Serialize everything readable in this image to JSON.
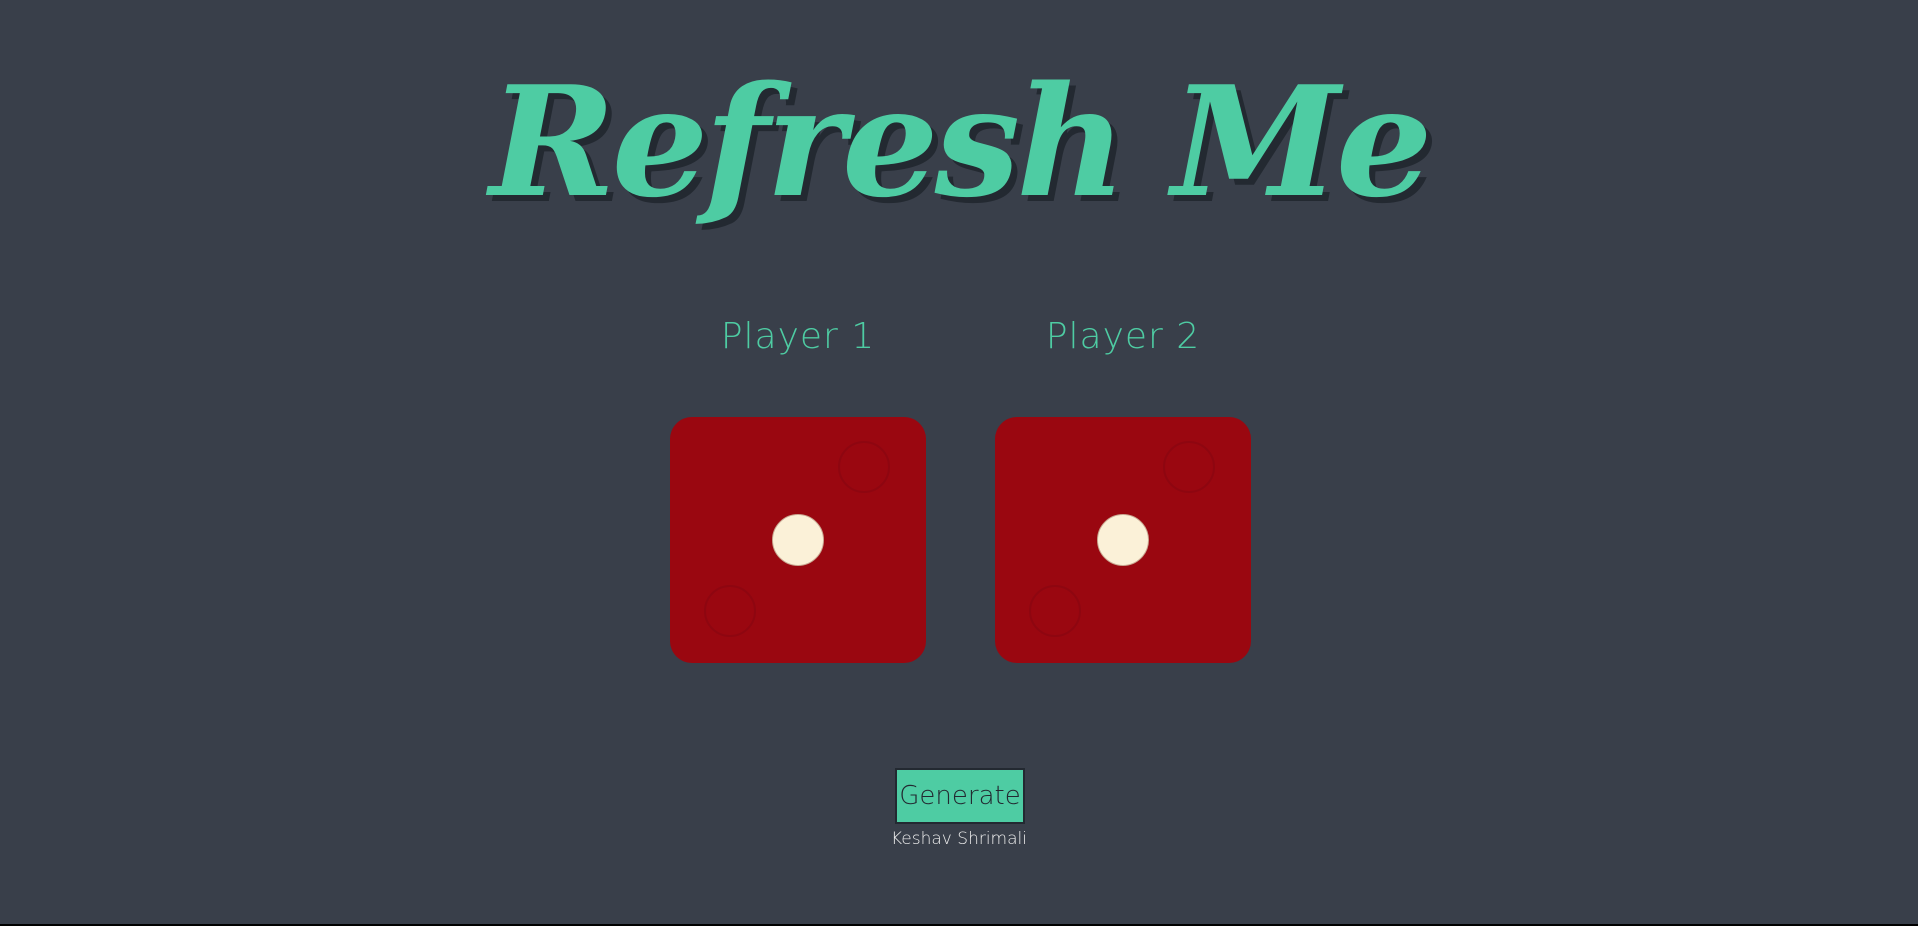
{
  "title": "Refresh Me",
  "players": [
    {
      "label": "Player 1",
      "die_value": 1
    },
    {
      "label": "Player 2",
      "die_value": 1
    }
  ],
  "button": {
    "label": "Generate"
  },
  "footer": {
    "author": "Keshav Shrimali"
  },
  "colors": {
    "background": "#393f4a",
    "accent": "#4ecca3",
    "die": "#9a0710",
    "pip": "#fbf1d8"
  }
}
